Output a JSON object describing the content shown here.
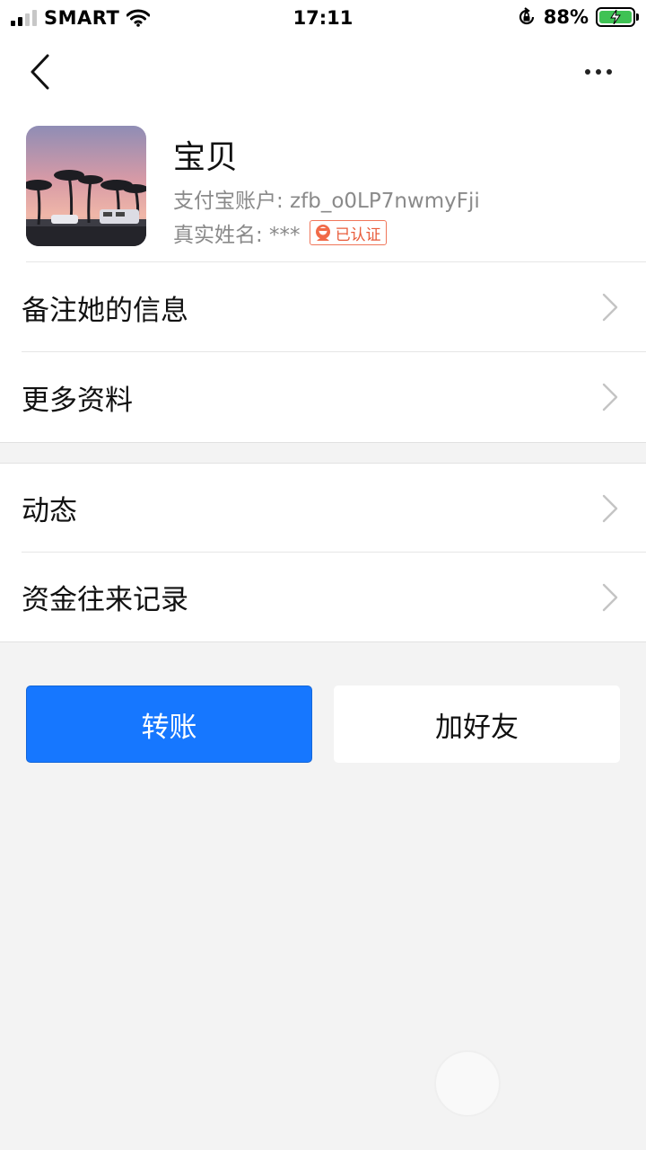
{
  "status_bar": {
    "carrier": "SMART",
    "time": "17:11",
    "battery_percent": "88%",
    "signal_bars": 2,
    "charging": true,
    "icons": [
      "signal-icon",
      "wifi-icon",
      "orientation-lock-icon",
      "battery-charging-icon"
    ]
  },
  "nav": {
    "back_icon": "chevron-left-icon",
    "more_icon": "more-dots-icon"
  },
  "profile": {
    "name": "宝贝",
    "account": "支付宝账户: zfb_o0LP7nwmyFji",
    "real_name": "真实姓名: ***",
    "verified_badge": "已认证"
  },
  "menu": {
    "group1": [
      {
        "label": "备注她的信息"
      },
      {
        "label": "更多资料"
      }
    ],
    "group2": [
      {
        "label": "动态"
      },
      {
        "label": "资金往来记录"
      }
    ]
  },
  "actions": {
    "transfer": "转账",
    "add_friend": "加好友"
  },
  "colors": {
    "primary": "#1677ff",
    "badge": "#e85b3a",
    "background": "#f3f3f3",
    "battery": "#3fc254"
  }
}
